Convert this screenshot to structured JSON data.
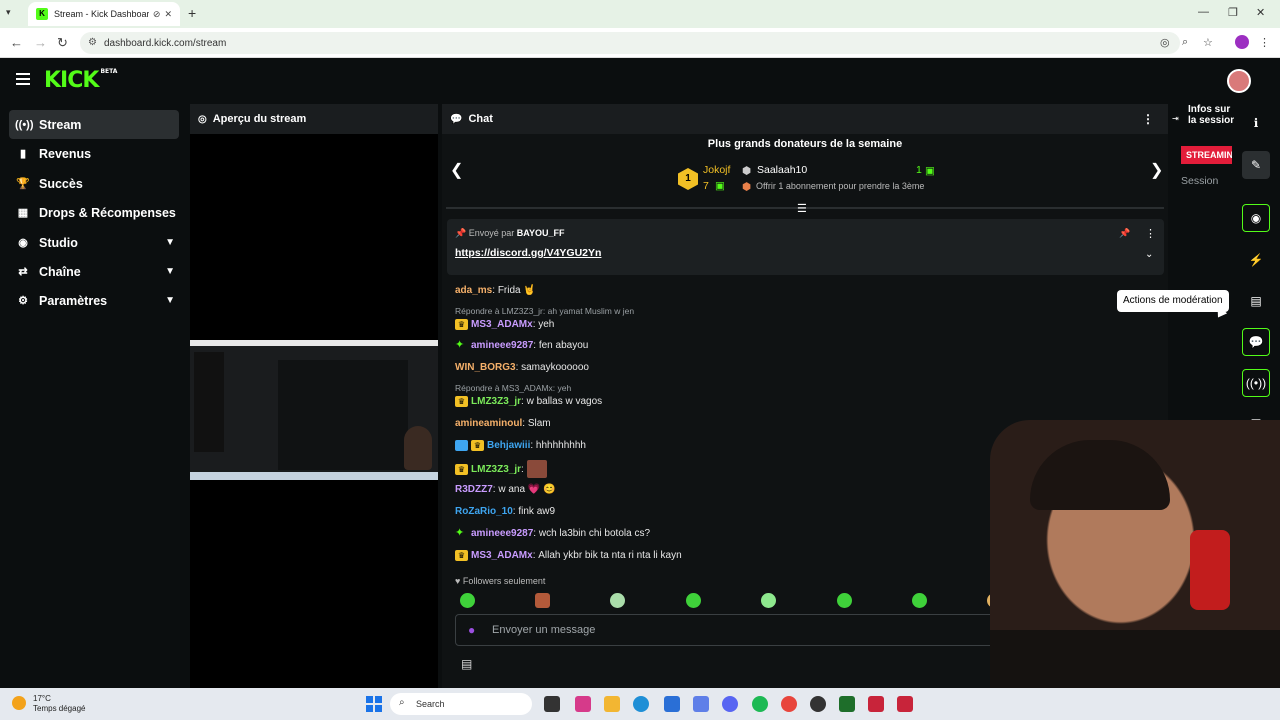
{
  "browser": {
    "tab_title": "Stream - Kick Dashboard",
    "url": "dashboard.kick.com/stream"
  },
  "header": {
    "logo": "KICK",
    "logo_badge": "BETA"
  },
  "sidebar": {
    "items": [
      {
        "label": "Stream",
        "icon": "stream-icon",
        "active": true
      },
      {
        "label": "Revenus",
        "icon": "chart-icon"
      },
      {
        "label": "Succès",
        "icon": "trophy-icon"
      },
      {
        "label": "Drops & Récompenses",
        "icon": "gift-icon"
      },
      {
        "label": "Studio",
        "icon": "camera-icon",
        "expandable": true
      },
      {
        "label": "Chaîne",
        "icon": "channel-icon",
        "expandable": true
      },
      {
        "label": "Paramètres",
        "icon": "gear-icon",
        "expandable": true
      }
    ]
  },
  "preview": {
    "title": "Aperçu du stream"
  },
  "chat": {
    "title": "Chat",
    "donors_title": "Plus grands donateurs de la semaine",
    "top1_rank": "1",
    "top1_name": "Jokojf",
    "top1_count": "7",
    "top2_name": "Saalaah10",
    "top2_count": "1",
    "top3_text": "Offrir 1 abonnement pour prendre la 3ème",
    "pinned": {
      "sent_by": "Envoyé par",
      "user": "BAYOU_FF",
      "link": "https://discord.gg/V4YGU2Yn"
    },
    "messages": [
      {
        "user": "ada_ms",
        "color": "#f5b06a",
        "text": "Frida 🤘"
      },
      {
        "user": "MS3_ADAMx",
        "color": "#c99cff",
        "text": "yeh",
        "reply": "Répondre à LMZ3Z3_jr: ah yamat Muslim w jen"
      },
      {
        "user": "amineee9287",
        "color": "#c99cff",
        "text": "fen abayou"
      },
      {
        "user": "WIN_BORG3",
        "color": "#f5b06a",
        "text": "samaykoooooo"
      },
      {
        "user": "LMZ3Z3_jr",
        "color": "#7bea5a",
        "text": "w ballas w vagos",
        "reply": "Répondre à MS3_ADAMx: yeh"
      },
      {
        "user": "amineaminoul",
        "color": "#f5b06a",
        "text": "Slam"
      },
      {
        "user": "Behjawiii",
        "color": "#3ea5f0",
        "text": "hhhhhhhhh"
      },
      {
        "user": "LMZ3Z3_jr",
        "color": "#7bea5a",
        "text": ""
      },
      {
        "user": "R3DZZ7",
        "color": "#c99cff",
        "text": "w ana 💗 😊"
      },
      {
        "user": "RoZaRio_10",
        "color": "#3ea5f0",
        "text": "fink aw9"
      },
      {
        "user": "amineee9287",
        "color": "#c99cff",
        "text": "wch la3bin chi botola cs?"
      },
      {
        "user": "MS3_ADAMx",
        "color": "#c99cff",
        "text": "Allah ykbr bik ta nta ri nta li kayn"
      }
    ],
    "followers_only": "Followers seulement",
    "input_placeholder": "Envoyer un message"
  },
  "session": {
    "title": "Infos sur la session",
    "status": "STREAMING",
    "label": "Session"
  },
  "tooltip": "Actions de modération",
  "taskbar": {
    "temp": "17°C",
    "weather": "Temps dégagé",
    "search": "Search"
  },
  "colors": {
    "kick_green": "#53fc18",
    "live_red": "#e31d3a"
  }
}
